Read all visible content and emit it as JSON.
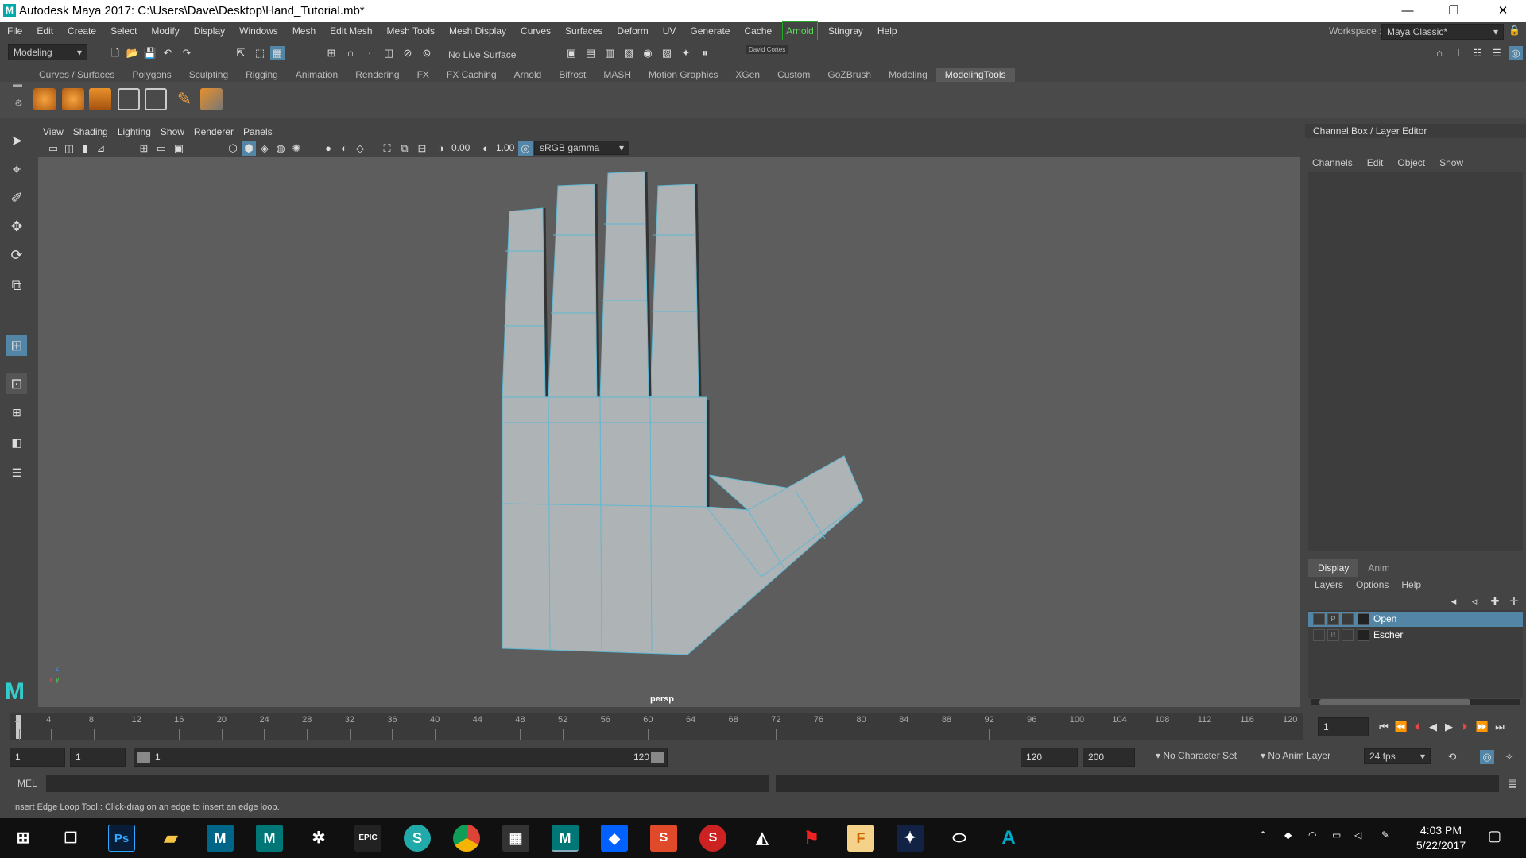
{
  "window": {
    "title": "Autodesk Maya 2017: C:\\Users\\Dave\\Desktop\\Hand_Tutorial.mb*",
    "controls": [
      "—",
      "❐",
      "✕"
    ]
  },
  "menubar": {
    "items": [
      "File",
      "Edit",
      "Create",
      "Select",
      "Modify",
      "Display",
      "Windows",
      "Mesh",
      "Edit Mesh",
      "Mesh Tools",
      "Mesh Display",
      "Curves",
      "Surfaces",
      "Deform",
      "UV",
      "Generate",
      "Cache",
      "Arnold",
      "Stingray",
      "Help"
    ],
    "workspace_label": "Workspace :",
    "workspace_value": "Maya Classic*"
  },
  "statusline": {
    "mode": "Modeling",
    "live_surface": "No Live Surface",
    "user": "David Cortes"
  },
  "shelf": {
    "tabs": [
      "Curves / Surfaces",
      "Polygons",
      "Sculpting",
      "Rigging",
      "Animation",
      "Rendering",
      "FX",
      "FX Caching",
      "Arnold",
      "Bifrost",
      "MASH",
      "Motion Graphics",
      "XGen",
      "Custom",
      "GoZBrush",
      "Modeling",
      "ModelingTools"
    ],
    "active_tab": "ModelingTools"
  },
  "viewport": {
    "menu": [
      "View",
      "Shading",
      "Lighting",
      "Show",
      "Renderer",
      "Panels"
    ],
    "exposure": "0.00",
    "gamma": "1.00",
    "colorspace": "sRGB gamma",
    "camera": "persp",
    "axis_x": "x",
    "axis_y": "y",
    "axis_z": "z"
  },
  "channelbox": {
    "title": "Channel Box / Layer Editor",
    "menu": [
      "Channels",
      "Edit",
      "Object",
      "Show"
    ]
  },
  "layereditor": {
    "tabs": [
      "Display",
      "Anim"
    ],
    "menu": [
      "Layers",
      "Options",
      "Help"
    ],
    "layers": [
      {
        "name": "Open",
        "flag": "P",
        "selected": true
      },
      {
        "name": "Escher",
        "flag": "R",
        "selected": false
      }
    ]
  },
  "timeline": {
    "ticks": [
      "1",
      "4",
      "8",
      "12",
      "16",
      "20",
      "24",
      "28",
      "32",
      "36",
      "40",
      "44",
      "48",
      "52",
      "56",
      "60",
      "64",
      "68",
      "72",
      "76",
      "80",
      "84",
      "88",
      "92",
      "96",
      "100",
      "104",
      "108",
      "112",
      "116",
      "120"
    ],
    "current_frame": "1"
  },
  "range": {
    "start": "1",
    "start_inner": "1",
    "slider_start": "1",
    "slider_end": "120",
    "end_inner": "120",
    "end": "200",
    "character_set": "No Character Set",
    "anim_layer": "No Anim Layer",
    "fps": "24 fps"
  },
  "cmdline": {
    "label": "MEL"
  },
  "helpline": {
    "text": "Insert Edge Loop Tool.: Click-drag on an edge to insert an edge loop."
  },
  "taskbar": {
    "time": "4:03 PM",
    "date": "5/22/2017",
    "apps": [
      "task-view",
      "photoshop",
      "file-explorer",
      "maya-2016",
      "maya-2018",
      "zbrush",
      "epic-games",
      "substance",
      "chrome",
      "calculator",
      "maya-2017",
      "dropbox",
      "substance-designer",
      "substance-painter",
      "unity",
      "acrobat",
      "fusion",
      "app-star",
      "oculus",
      "autodesk"
    ]
  },
  "colors": {
    "accent": "#5285a6",
    "viewport_bg": "#5d5d5d",
    "mesh_fill": "#aeb3b6",
    "wire": "#5fb8d3"
  }
}
